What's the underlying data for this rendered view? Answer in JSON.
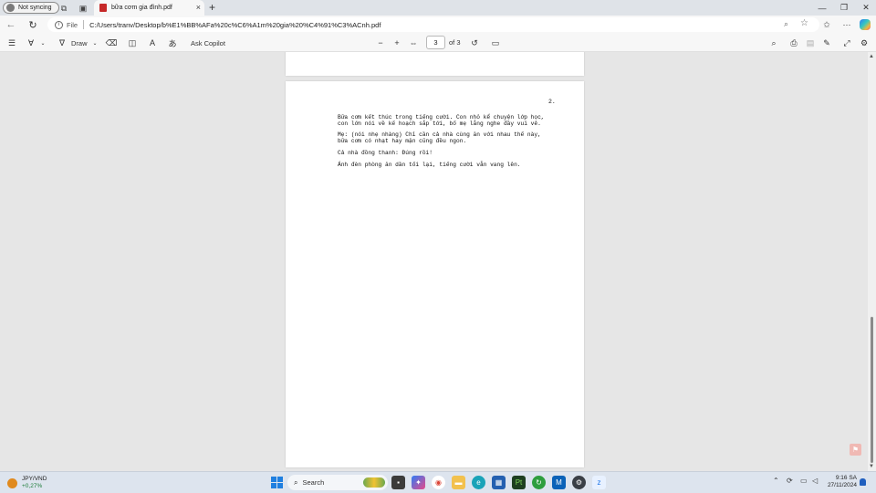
{
  "browser": {
    "profile_label": "Not syncing",
    "tab_title": "bữa cơm gia đình.pdf",
    "tab_close": "×",
    "new_tab": "+",
    "address": {
      "scheme_label": "File",
      "url": "C:/Users/tranv/Desktop/b%E1%BB%AFa%20c%C6%A1m%20gia%20%C4%91%C3%ACnh.pdf"
    }
  },
  "pdf_toolbar": {
    "draw_label": "Draw",
    "ask_copilot_label": "Ask Copilot",
    "page_current": "3",
    "page_total": "of 3"
  },
  "document": {
    "page_number": "2.",
    "paragraphs": [
      "Bữa cơm kết thúc trong tiếng cười. Con nhỏ kể chuyện lớp học,\ncon lớn nói về kế hoạch sắp tới, bố mẹ lắng nghe đầy vui vẻ.",
      "Mẹ: (nói nhẹ nhàng) Chỉ cần cả nhà cùng ăn với nhau thế này,\nbữa cơm có nhạt hay mặn cũng đều ngon.",
      "Cả nhà đồng thanh: Đúng rồi!",
      "Ánh đèn phòng ăn dần tối lại, tiếng cười vẫn vang lên."
    ]
  },
  "taskbar": {
    "weather_symbol": "JPY/VND",
    "weather_change": "+0,27%",
    "search_label": "Search",
    "time": "9:16 SA",
    "date": "27/11/2024"
  },
  "colors": {
    "accent": "#1f7fe0",
    "pdf_red": "#c62828",
    "positive": "#1e7d3a"
  }
}
